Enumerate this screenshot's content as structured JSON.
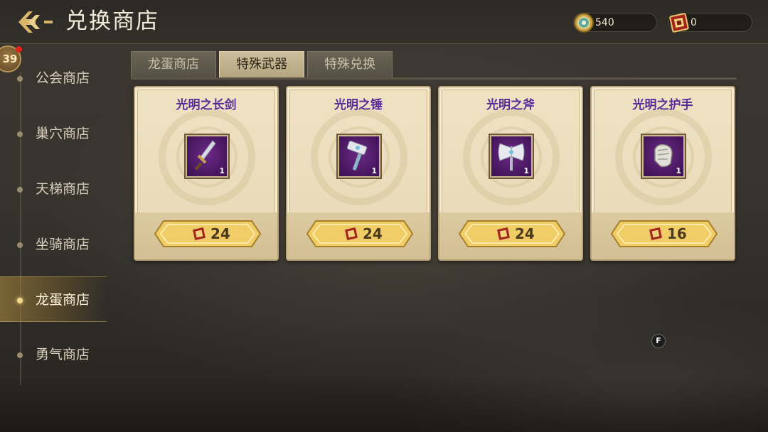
{
  "header": {
    "title": "兑换商店",
    "back_icon": "back-arrow-icon",
    "currencies": [
      {
        "icon": "gold-coin-icon",
        "value": "540"
      },
      {
        "icon": "exchange-ticket-icon",
        "value": "0"
      }
    ]
  },
  "sidebar": {
    "level_badge": "39",
    "items": [
      {
        "label": "公会商店",
        "active": false
      },
      {
        "label": "巢穴商店",
        "active": false
      },
      {
        "label": "天梯商店",
        "active": false
      },
      {
        "label": "坐骑商店",
        "active": false
      },
      {
        "label": "龙蛋商店",
        "active": true
      },
      {
        "label": "勇气商店",
        "active": false
      }
    ]
  },
  "tabs": [
    {
      "label": "龙蛋商店",
      "active": false
    },
    {
      "label": "特殊武器",
      "active": true
    },
    {
      "label": "特殊兑换",
      "active": false
    }
  ],
  "products": [
    {
      "name": "光明之长剑",
      "icon": "longsword-icon",
      "qty": "1",
      "price": "24",
      "price_icon": "exchange-ticket-icon"
    },
    {
      "name": "光明之锤",
      "icon": "hammer-icon",
      "qty": "1",
      "price": "24",
      "price_icon": "exchange-ticket-icon"
    },
    {
      "name": "光明之斧",
      "icon": "axe-icon",
      "qty": "1",
      "price": "24",
      "price_icon": "exchange-ticket-icon"
    },
    {
      "name": "光明之护手",
      "icon": "gauntlet-icon",
      "qty": "1",
      "price": "16",
      "price_icon": "exchange-ticket-icon"
    }
  ],
  "overlay_badge": "F",
  "colors": {
    "item_name": "#5a2c9a",
    "active_tab": "#c9bb98",
    "price_button": "#f2cf6a"
  }
}
